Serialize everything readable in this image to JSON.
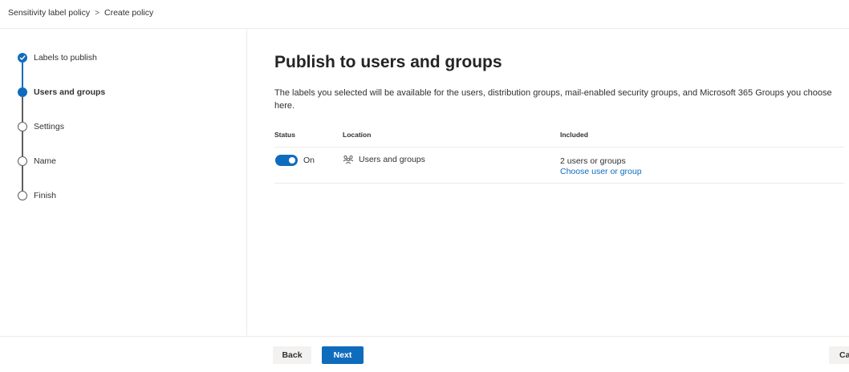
{
  "breadcrumb": {
    "items": [
      "Sensitivity label policy",
      "Create policy"
    ],
    "separator": ">"
  },
  "steps": [
    {
      "label": "Labels to publish",
      "state": "done"
    },
    {
      "label": "Users and groups",
      "state": "current"
    },
    {
      "label": "Settings",
      "state": "pending"
    },
    {
      "label": "Name",
      "state": "pending"
    },
    {
      "label": "Finish",
      "state": "pending"
    }
  ],
  "main": {
    "title": "Publish to users and groups",
    "description": "The labels you selected will be available for the users, distribution groups, mail-enabled security groups, and Microsoft 365 Groups you choose here.",
    "table": {
      "headers": {
        "status": "Status",
        "location": "Location",
        "included": "Included"
      },
      "rows": [
        {
          "status_label": "On",
          "status_on": true,
          "location_icon": "users-groups-icon",
          "location": "Users and groups",
          "included_count": "2 users or groups",
          "included_link": "Choose user or group"
        }
      ]
    }
  },
  "footer": {
    "back_label": "Back",
    "next_label": "Next",
    "cancel_label": "Ca"
  },
  "colors": {
    "accent": "#0f6cbd",
    "divider": "#edebe9"
  }
}
